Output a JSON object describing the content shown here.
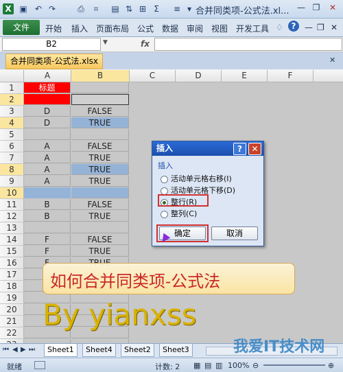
{
  "window": {
    "title": "合并同类项-公式法.xl..."
  },
  "ribbon": {
    "file_tab": "文件",
    "tabs": [
      "开始",
      "插入",
      "页面布局",
      "公式",
      "数据",
      "审阅",
      "视图",
      "开发工具"
    ]
  },
  "formula_bar": {
    "name_box": "B2",
    "fx": "fx",
    "value": ""
  },
  "workbook_tab": "合并同类项-公式法.xlsx",
  "columns": [
    "A",
    "B",
    "C",
    "D",
    "E",
    "F"
  ],
  "rows": [
    {
      "n": "1",
      "a": "标题",
      "b": ""
    },
    {
      "n": "2",
      "a": "",
      "b": ""
    },
    {
      "n": "3",
      "a": "D",
      "b": "FALSE"
    },
    {
      "n": "4",
      "a": "D",
      "b": "TRUE"
    },
    {
      "n": "5",
      "a": "",
      "b": ""
    },
    {
      "n": "6",
      "a": "A",
      "b": "FALSE"
    },
    {
      "n": "7",
      "a": "A",
      "b": "TRUE"
    },
    {
      "n": "8",
      "a": "A",
      "b": "TRUE"
    },
    {
      "n": "9",
      "a": "A",
      "b": "TRUE"
    },
    {
      "n": "10",
      "a": "",
      "b": ""
    },
    {
      "n": "11",
      "a": "B",
      "b": "FALSE"
    },
    {
      "n": "12",
      "a": "B",
      "b": "TRUE"
    },
    {
      "n": "13",
      "a": "",
      "b": ""
    },
    {
      "n": "14",
      "a": "F",
      "b": "FALSE"
    },
    {
      "n": "15",
      "a": "F",
      "b": "TRUE"
    },
    {
      "n": "16",
      "a": "F",
      "b": "TRUE"
    },
    {
      "n": "17",
      "a": "",
      "b": ""
    },
    {
      "n": "18",
      "a": "",
      "b": ""
    },
    {
      "n": "19",
      "a": "",
      "b": ""
    },
    {
      "n": "20",
      "a": "",
      "b": ""
    },
    {
      "n": "21",
      "a": "",
      "b": ""
    },
    {
      "n": "22",
      "a": "",
      "b": ""
    },
    {
      "n": "23",
      "a": "",
      "b": ""
    }
  ],
  "dialog": {
    "title": "插入",
    "help": "?",
    "close": "✕",
    "group": "插入",
    "options": [
      "活动单元格右移(I)",
      "活动单元格下移(D)",
      "整行(R)",
      "整列(C)"
    ],
    "selected_option": 2,
    "ok": "确定",
    "cancel": "取消"
  },
  "banner": "如何合并同类项-公式法",
  "byline": "By  yianxss",
  "sheet_tabs": [
    "Sheet1",
    "Sheet4",
    "Sheet2",
    "Sheet3"
  ],
  "active_sheet": 0,
  "status": {
    "ready": "就绪",
    "count": "计数: 2",
    "zoom": "100%"
  },
  "watermark": "我爱IT技术网",
  "colors": {
    "header_red": "#ff0000",
    "highlight_blue": "#95b3d7",
    "accent_yellow": "#f7c75d"
  }
}
